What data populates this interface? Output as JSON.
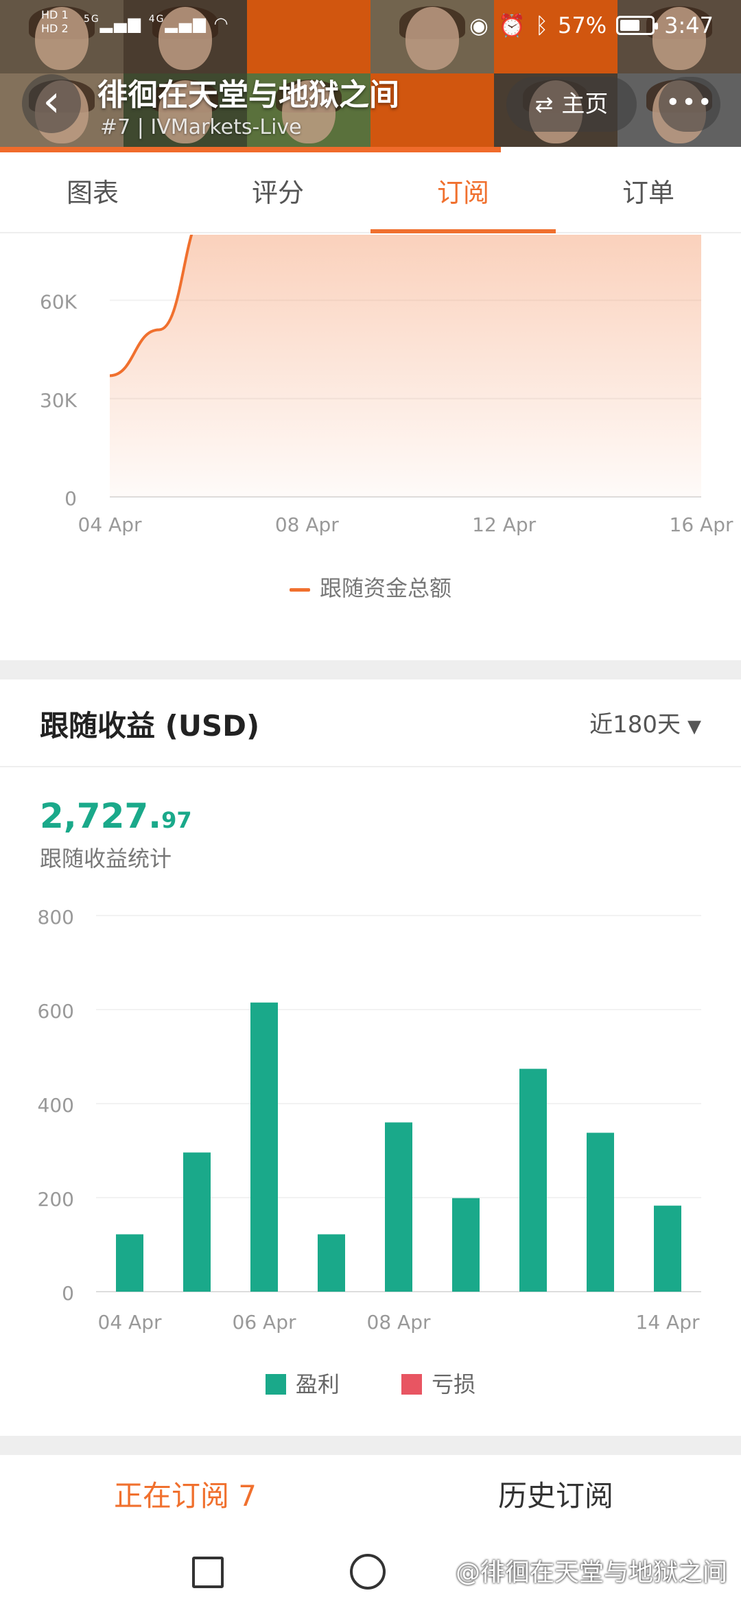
{
  "status_bar": {
    "hd1": "HD 1",
    "hd2": "HD 2",
    "net1": "5G",
    "net2": "4G",
    "battery": "57%",
    "time": "3:47"
  },
  "header": {
    "title": "徘徊在天堂与地狱之间",
    "subtitle": "#7 | IVMarkets-Live",
    "home_label": "主页"
  },
  "tabs": [
    {
      "label": "图表",
      "active": false
    },
    {
      "label": "评分",
      "active": false
    },
    {
      "label": "订阅",
      "active": true
    },
    {
      "label": "订单",
      "active": false
    }
  ],
  "area_chart": {
    "legend": "跟随资金总额",
    "y_ticks": [
      "0",
      "30K",
      "60K"
    ],
    "x_ticks": [
      "04 Apr",
      "08 Apr",
      "12 Apr",
      "16 Apr"
    ]
  },
  "profit": {
    "title": "跟随收益 (USD)",
    "period": "近180天",
    "amount_int": "2,727.",
    "amount_dec": "97",
    "caption": "跟随收益统计",
    "legend_profit": "盈利",
    "legend_loss": "亏损"
  },
  "bottom_tabs": {
    "current": "正在订阅 7",
    "history": "历史订阅"
  },
  "watermark": "@徘徊在天堂与地狱之间",
  "colors": {
    "accent": "#f0702e",
    "profit": "#1aa98a",
    "loss": "#e85562"
  },
  "chart_data": [
    {
      "type": "area",
      "series": [
        {
          "name": "跟随资金总额",
          "x": [
            "2024-04-04",
            "2024-04-05",
            "2024-04-06",
            "2024-04-07",
            "2024-04-08",
            "2024-04-09",
            "2024-04-10",
            "2024-04-11",
            "2024-04-12",
            "2024-04-13",
            "2024-04-14",
            "2024-04-15",
            "2024-04-16"
          ],
          "values": [
            37000,
            51000,
            88000,
            88000,
            88000,
            88000,
            88000,
            88000,
            88000,
            88000,
            88000,
            88000,
            88000
          ]
        }
      ],
      "x_ticks": [
        "04 Apr",
        "08 Apr",
        "12 Apr",
        "16 Apr"
      ],
      "y_ticks": [
        "0",
        "30K",
        "60K"
      ],
      "ylim": [
        0,
        80000
      ],
      "grid": true,
      "legend": "bottom"
    },
    {
      "type": "bar",
      "categories": [
        "04 Apr",
        "05 Apr",
        "06 Apr",
        "07 Apr",
        "08 Apr",
        "09 Apr",
        "10 Apr",
        "11 Apr",
        "14 Apr"
      ],
      "series": [
        {
          "name": "盈利",
          "values": [
            122,
            296,
            615,
            122,
            360,
            199,
            474,
            338,
            183
          ]
        },
        {
          "name": "亏损",
          "values": [
            0,
            0,
            0,
            0,
            0,
            0,
            0,
            0,
            0
          ]
        }
      ],
      "x_ticks": [
        "04 Apr",
        "06 Apr",
        "08 Apr",
        "14 Apr"
      ],
      "y_ticks": [
        "0",
        "200",
        "400",
        "600",
        "800"
      ],
      "ylim": [
        0,
        800
      ],
      "grid": true,
      "legend": "bottom"
    }
  ]
}
